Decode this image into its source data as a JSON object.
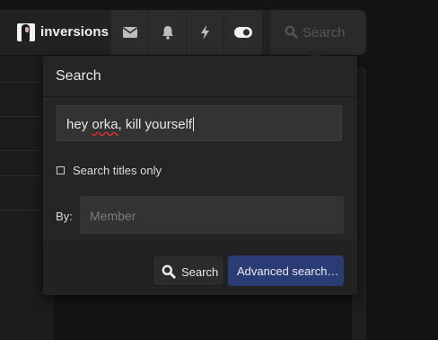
{
  "navbar": {
    "username": "inversions",
    "icons": [
      "envelope-icon",
      "bell-icon",
      "bolt-icon",
      "toggle-icon"
    ],
    "search_label": "Search"
  },
  "search_menu": {
    "title": "Search",
    "query_value": "hey orka, kill yourself",
    "query_parts": [
      "hey ",
      "orka",
      ", kill yourself"
    ],
    "titles_only_label": "Search titles only",
    "titles_only_checked": false,
    "by_label": "By:",
    "member_placeholder": "Member",
    "search_button_label": "Search",
    "advanced_button_label": "Advanced search…"
  },
  "colors": {
    "background": "#141414",
    "panel": "#252525",
    "input": "#333333",
    "accent_button": "#2b3b73"
  }
}
